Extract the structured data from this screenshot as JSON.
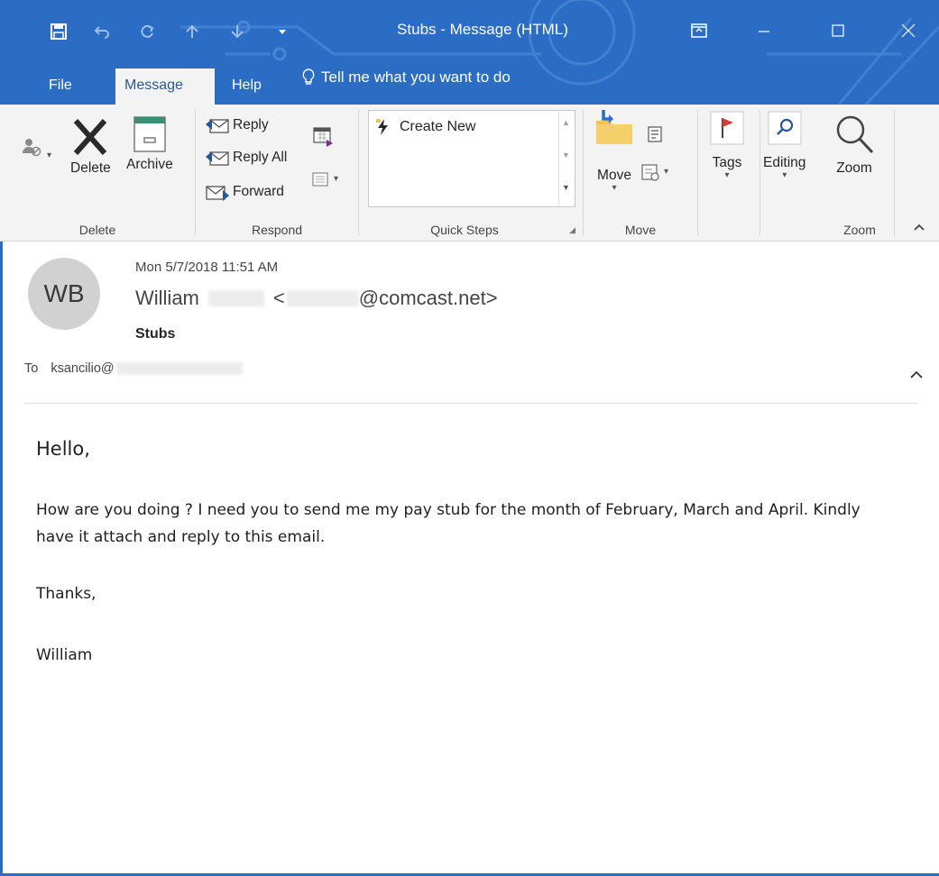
{
  "window": {
    "title": "Stubs  -  Message (HTML)"
  },
  "tabs": [
    {
      "label": "File"
    },
    {
      "label": "Message",
      "active": true
    },
    {
      "label": "Help"
    }
  ],
  "tell_me": {
    "text": "Tell me what you want to do"
  },
  "ribbon": {
    "delete_group": {
      "label": "Delete",
      "delete_label": "Delete",
      "archive_label": "Archive"
    },
    "respond_group": {
      "label": "Respond",
      "reply_label": "Reply",
      "reply_all_label": "Reply All",
      "forward_label": "Forward"
    },
    "quick_steps_group": {
      "label": "Quick Steps",
      "item_label": "Create New"
    },
    "move_group": {
      "label": "Move",
      "move_label": "Move"
    },
    "tags_label": "Tags",
    "editing_label": "Editing",
    "zoom_group": {
      "label": "Zoom",
      "zoom_label": "Zoom"
    }
  },
  "message": {
    "avatar_initials": "WB",
    "date": "Mon 5/7/2018 11:51 AM",
    "sender_first_name": "William",
    "sender_email_open": "<",
    "sender_email_domain": "@comcast.net>",
    "subject": "Stubs",
    "to_label": "To",
    "to_address_prefix": "ksancilio@",
    "body": {
      "greeting": "Hello,",
      "paragraph1": "How are you doing ? I need you to send me my pay stub for the month of February, March and April. Kindly have it attach and reply to this email.",
      "closing": "Thanks,",
      "signature": "William"
    }
  },
  "colors": {
    "chrome_blue": "#2b6cc4",
    "ribbon_bg": "#f3f3f3",
    "flag_red": "#d63c2f",
    "folder_yellow": "#f2c14e",
    "accent_blue": "#2b5797"
  }
}
